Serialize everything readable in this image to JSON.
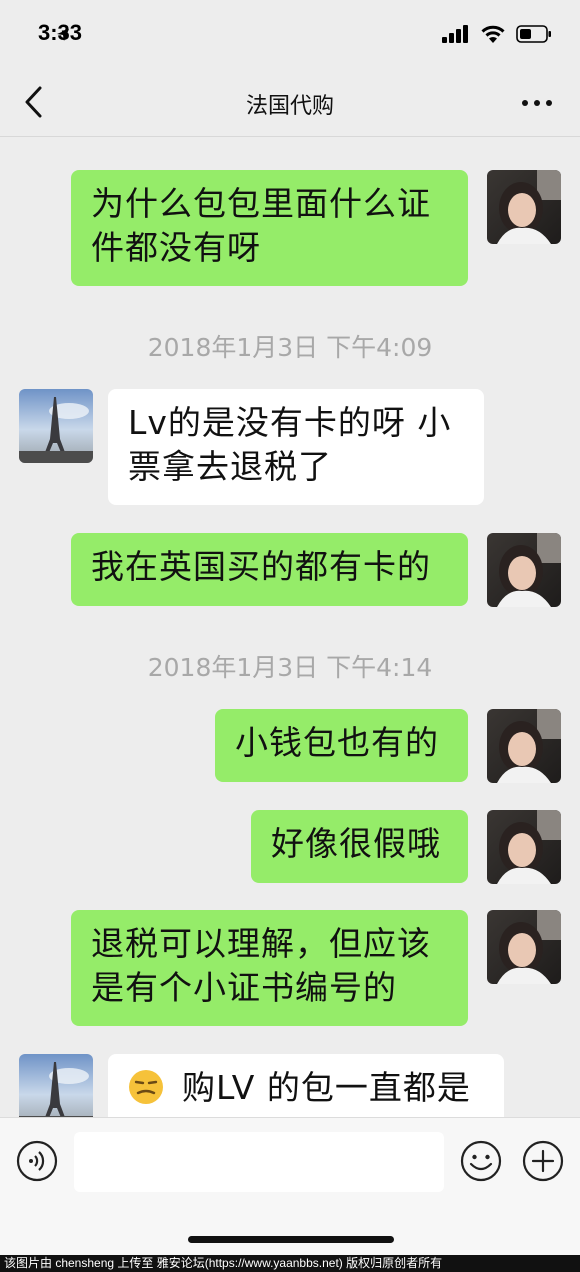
{
  "status": {
    "time": "3:33"
  },
  "nav": {
    "title": "法国代购"
  },
  "messages": {
    "m1": {
      "line1": "为什么包包里面什么证",
      "line2": "件都没有呀"
    },
    "ts1": "2018年1月3日 下午4:09",
    "m2": {
      "line1": "Lv的是没有卡的呀 小",
      "line2": "票拿去退税了"
    },
    "m3": "我在英国买的都有卡的",
    "ts2": "2018年1月3日 下午4:14",
    "m4": "小钱包也有的",
    "m5": "好像很假哦",
    "m6": {
      "line1": "退税可以理解，但应该",
      "line2": "是有个小证书编号的"
    },
    "m7": "购LV 的包一直都是"
  },
  "input": {
    "value": ""
  },
  "footer": {
    "text": "该图片由 chensheng 上传至 雅安论坛(https://www.yaanbbs.net) 版权归原创者所有"
  },
  "colors": {
    "me_bubble": "#95ec69",
    "them_bubble": "#ffffff",
    "background": "#ededed"
  }
}
